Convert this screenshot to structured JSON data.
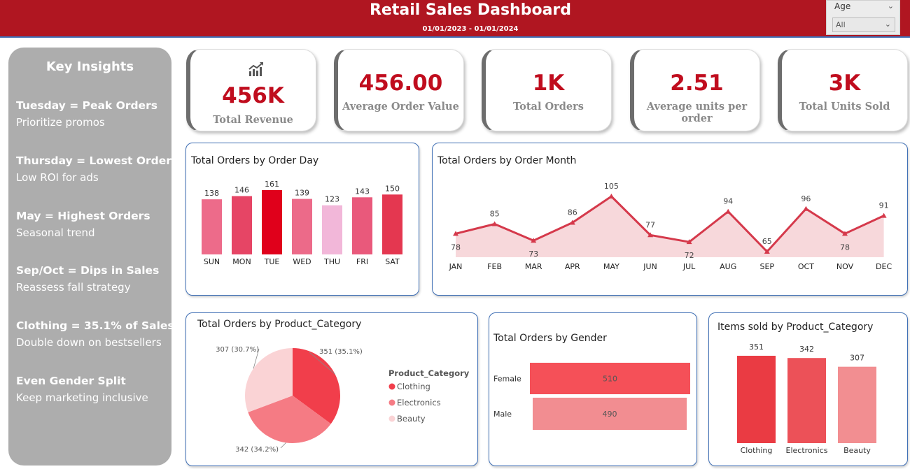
{
  "header": {
    "title": "Retail Sales Dashboard",
    "date_range": "01/01/2023 - 01/01/2024"
  },
  "slicer": {
    "label": "Age",
    "value": "All"
  },
  "insights": {
    "title": "Key Insights",
    "items": [
      {
        "heading": "Tuesday = Peak Orders",
        "sub": "Prioritize promos"
      },
      {
        "heading": "Thursday = Lowest Orders",
        "sub": "Low ROI for ads"
      },
      {
        "heading": "May = Highest Orders",
        "sub": "Seasonal trend"
      },
      {
        "heading": "Sep/Oct = Dips in Sales",
        "sub": "Reassess fall strategy"
      },
      {
        "heading": "Clothing = 35.1% of Sales",
        "sub": "Double down on bestsellers"
      },
      {
        "heading": "Even Gender Split",
        "sub": "Keep marketing inclusive"
      }
    ]
  },
  "kpis": [
    {
      "value": "456K",
      "label": "Total Revenue",
      "icon": "chart-trend-icon"
    },
    {
      "value": "456.00",
      "label": "Average Order Value"
    },
    {
      "value": "1K",
      "label": "Total Orders"
    },
    {
      "value": "2.51",
      "label": "Average units per order"
    },
    {
      "value": "3K",
      "label": "Total Units Sold"
    }
  ],
  "chart_data": [
    {
      "type": "bar",
      "title": "Total Orders by Order Day",
      "categories": [
        "SUN",
        "MON",
        "TUE",
        "WED",
        "THU",
        "FRI",
        "SAT"
      ],
      "values": [
        138,
        146,
        161,
        139,
        123,
        143,
        150
      ],
      "colors": [
        "#ed6b8a",
        "#e64565",
        "#e0001b",
        "#ec6a89",
        "#f2b7d9",
        "#e9597b",
        "#e43750"
      ],
      "ylim": [
        0,
        161
      ]
    },
    {
      "type": "area",
      "title": "Total Orders by Order Month",
      "categories": [
        "JAN",
        "FEB",
        "MAR",
        "APR",
        "MAY",
        "JUN",
        "JUL",
        "AUG",
        "SEP",
        "OCT",
        "NOV",
        "DEC"
      ],
      "values": [
        78,
        85,
        73,
        86,
        105,
        77,
        72,
        94,
        65,
        96,
        78,
        91
      ],
      "label_positions": [
        "below",
        "above",
        "below",
        "above",
        "above",
        "above",
        "below",
        "above",
        "above",
        "above",
        "below",
        "above"
      ],
      "line_color": "#d5394b",
      "fill_color": "#f7d8db",
      "ylim": [
        65,
        105
      ]
    },
    {
      "type": "pie",
      "title": "Total Orders by Product_Category",
      "legend_title": "Product_Category",
      "legend_position": "right",
      "slices": [
        {
          "name": "Clothing",
          "value": 351,
          "label": "351 (35.1%)",
          "color": "#f13e4b"
        },
        {
          "name": "Electronics",
          "value": 342,
          "label": "342 (34.2%)",
          "color": "#f57b84"
        },
        {
          "name": "Beauty",
          "value": 307,
          "label": "307 (30.7%)",
          "color": "#fad3d5"
        }
      ]
    },
    {
      "type": "bar",
      "orientation": "horizontal",
      "title": "Total Orders by Gender",
      "categories": [
        "Female",
        "Male"
      ],
      "values": [
        510,
        490
      ],
      "colors": [
        "#f55058",
        "#f28d91"
      ],
      "xlim": [
        0,
        510
      ]
    },
    {
      "type": "bar",
      "title": "Items sold by Product_Category",
      "categories": [
        "Clothing",
        "Electronics",
        "Beauty"
      ],
      "values": [
        351,
        342,
        307
      ],
      "colors": [
        "#ea3b43",
        "#ec5158",
        "#f28e91"
      ],
      "ylim": [
        0,
        351
      ]
    }
  ]
}
